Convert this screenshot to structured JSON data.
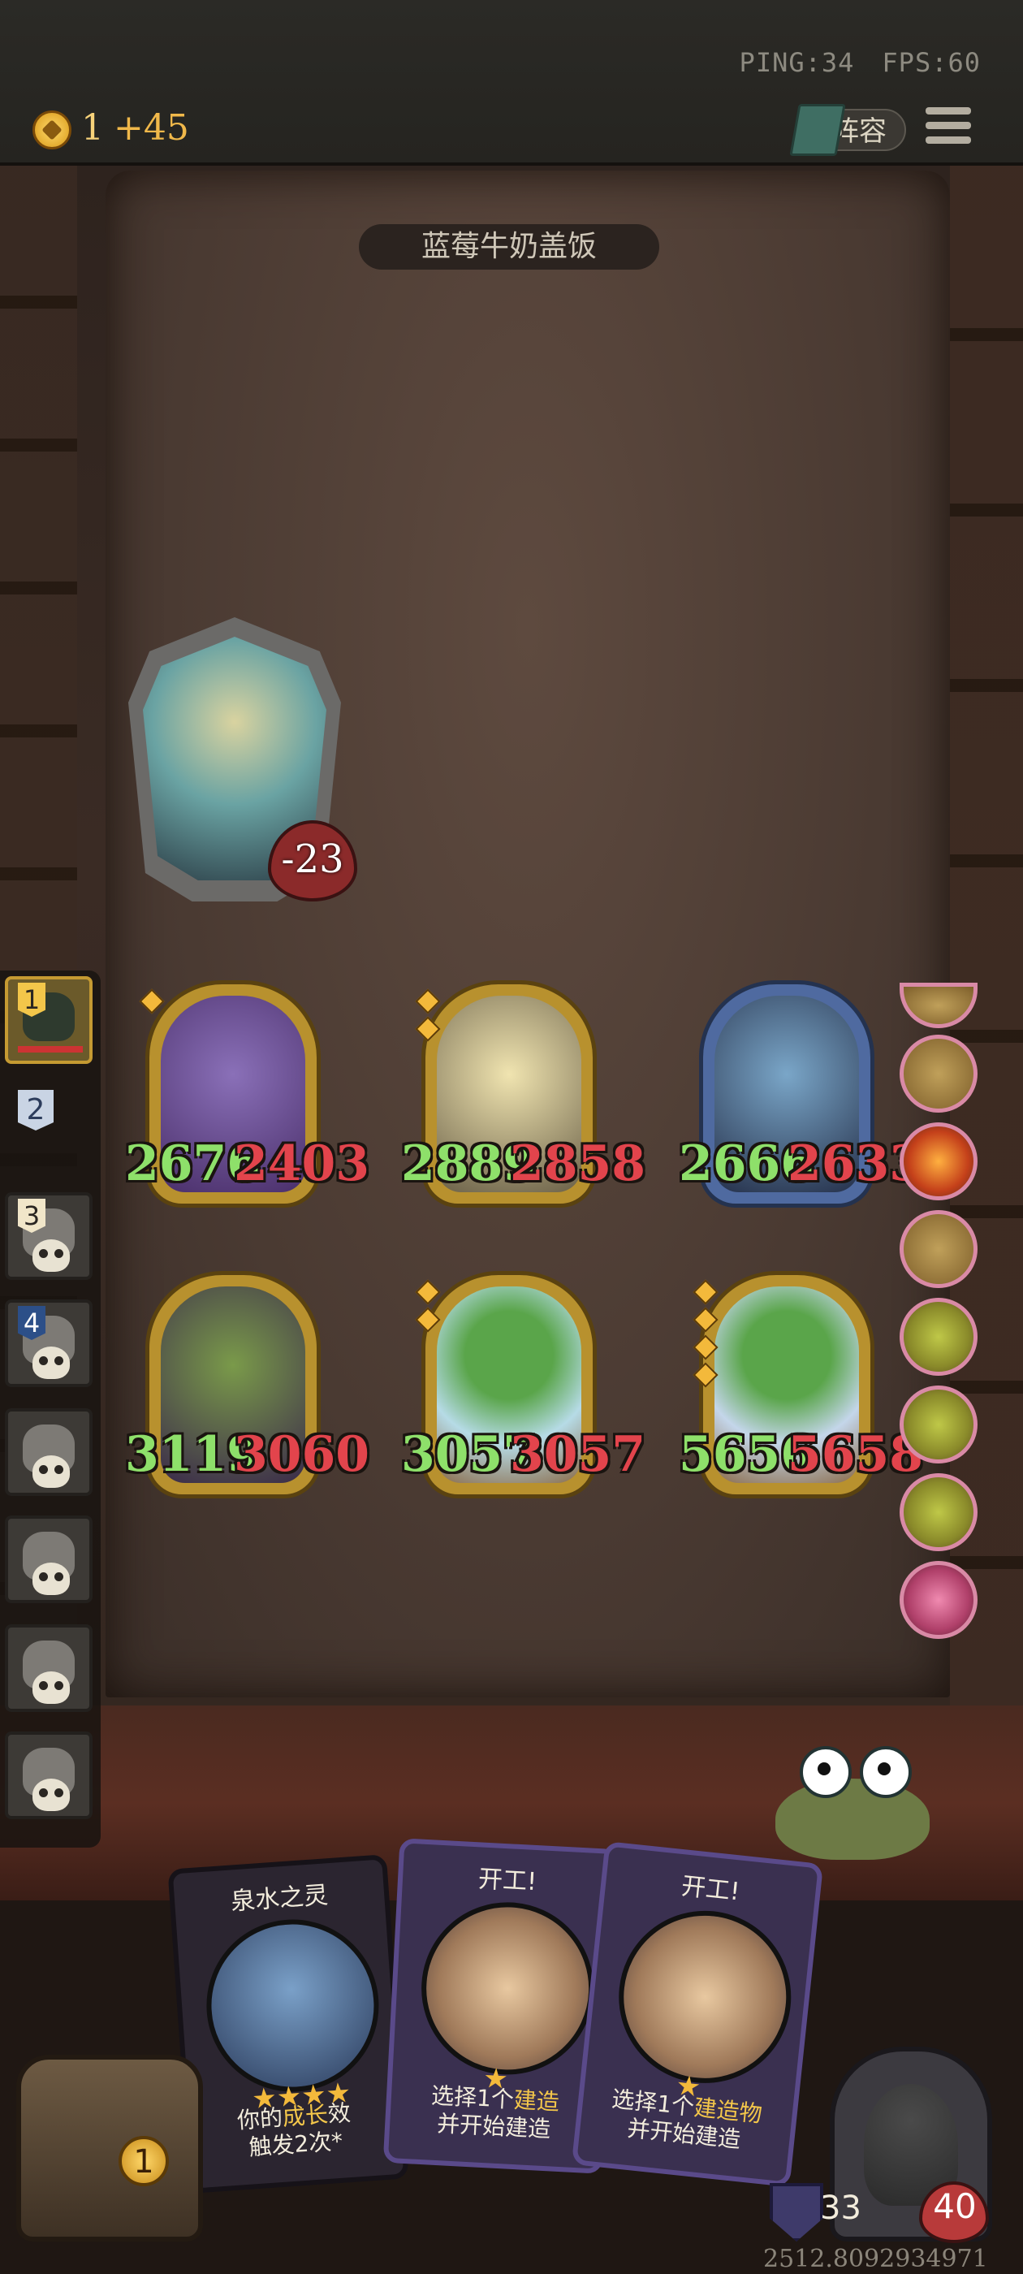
{
  "hud": {
    "ping": "PING:34",
    "fps": "FPS:60",
    "gold": "1",
    "gold_income": "+45",
    "lineup_label": "阵容"
  },
  "opponent": {
    "name": "蓝莓牛奶盖饭",
    "damage": "-23"
  },
  "sidebar": {
    "slots": [
      {
        "rank": "1",
        "eliminated": false
      },
      {
        "rank": "2",
        "eliminated": false
      },
      {
        "rank": "3",
        "eliminated": true
      },
      {
        "rank": "4",
        "eliminated": true
      },
      {
        "rank": "",
        "eliminated": true
      },
      {
        "rank": "",
        "eliminated": true
      },
      {
        "rank": "",
        "eliminated": true
      },
      {
        "rank": "",
        "eliminated": true
      }
    ]
  },
  "board": {
    "minions": [
      {
        "attack": "2676",
        "health": "2403",
        "frame": "gold"
      },
      {
        "attack": "2889",
        "health": "2858",
        "frame": "gold"
      },
      {
        "attack": "2666",
        "health": "2633",
        "frame": "blue"
      },
      {
        "attack": "3119",
        "health": "3060",
        "frame": "gold"
      },
      {
        "attack": "3057",
        "health": "3057",
        "frame": "gold"
      },
      {
        "attack": "5656",
        "health": "5658",
        "frame": "gold"
      }
    ]
  },
  "cards": [
    {
      "title": "泉水之灵",
      "desc_prefix": "你的",
      "desc_highlight": "成长",
      "desc_suffix": "效",
      "desc_line2": "触发2次*",
      "stars": 4
    },
    {
      "title": "开工!",
      "desc_prefix": "选择1个",
      "desc_highlight": "建造",
      "desc_suffix": "",
      "desc_line2": "并开始建造",
      "stars": 1
    },
    {
      "title": "开工!",
      "desc_prefix": "选择1个",
      "desc_highlight": "建造物",
      "desc_suffix": "",
      "desc_line2": "并开始建造",
      "stars": 1
    }
  ],
  "player": {
    "tavern_coins": "1",
    "armor": "33",
    "health": "40"
  },
  "footer": {
    "coordinate": "2512.8092934971"
  },
  "colors": {
    "attack": "#8ee06a",
    "health": "#e2444c",
    "gold": "#f7d27a"
  }
}
